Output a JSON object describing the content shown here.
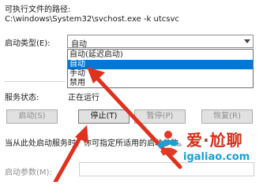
{
  "path": {
    "label": "可执行文件的路径:",
    "value": "C:\\windows\\System32\\svchost.exe -k utcsvc"
  },
  "startup": {
    "label": "启动类型(E):",
    "selected": "自动",
    "options": [
      "自动(延迟启动)",
      "自动",
      "手动",
      "禁用"
    ],
    "highlighted_index": 1
  },
  "status": {
    "label": "服务状态:",
    "value": "正在运行"
  },
  "buttons": {
    "start": "启动(S)",
    "stop": "停止(T)",
    "pause": "暂停(P)",
    "resume": "恢复(R)"
  },
  "hint": "当从此处启动服务时，你可指定所适用的启动参数。",
  "params": {
    "label": "启动参数(M):",
    "value": ""
  },
  "watermark": {
    "title": "爱·尬聊",
    "url": "igaliao.com"
  },
  "colors": {
    "highlight": "#0078d7",
    "arrow": "#e0301e",
    "watermark_red": "#d4301b",
    "watermark_blue": "#18a0d6"
  }
}
